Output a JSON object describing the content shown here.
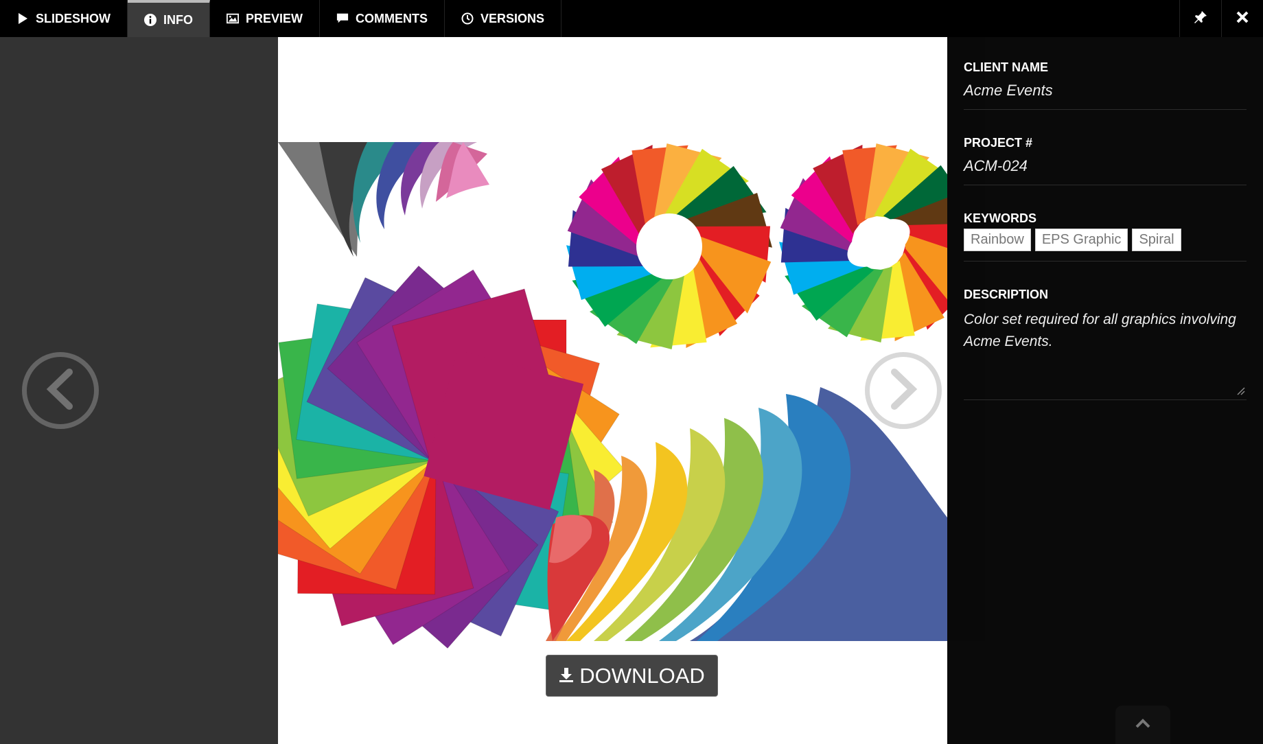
{
  "tabs": [
    {
      "label": "SLIDESHOW",
      "icon": "play-icon",
      "active": false
    },
    {
      "label": "INFO",
      "icon": "info-icon",
      "active": true
    },
    {
      "label": "PREVIEW",
      "icon": "image-icon",
      "active": false
    },
    {
      "label": "COMMENTS",
      "icon": "comment-icon",
      "active": false
    },
    {
      "label": "VERSIONS",
      "icon": "clock-icon",
      "active": false
    }
  ],
  "toolbar": {
    "pin_icon": "pin-icon",
    "close_icon": "close-icon"
  },
  "download": {
    "label": "DOWNLOAD",
    "icon": "download-icon"
  },
  "info": {
    "client_name": {
      "label": "CLIENT NAME",
      "value": "Acme Events"
    },
    "project": {
      "label": "PROJECT #",
      "value": "ACM-024"
    },
    "keywords": {
      "label": "KEYWORDS",
      "items": [
        "Rainbow",
        "EPS Graphic",
        "Spiral"
      ]
    },
    "description": {
      "label": "DESCRIPTION",
      "value": "Color set required for all graphics involving Acme Events."
    }
  },
  "colors": {
    "accent": "#ffffff",
    "panel": "#080808",
    "background": "#333333"
  }
}
